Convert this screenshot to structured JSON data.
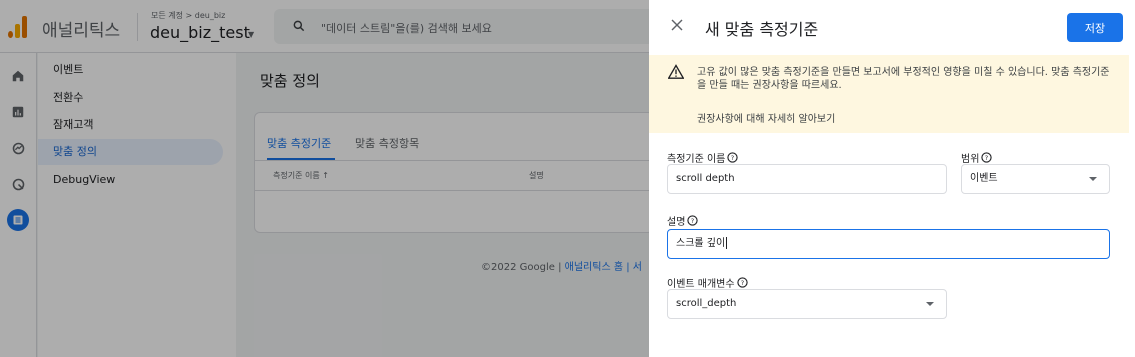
{
  "app": {
    "name": "애널리틱스",
    "account_path": "모든 계정 > deu_biz",
    "property": "deu_biz_test",
    "search_placeholder": "\"데이터 스트림\"을(를) 검색해 보세요"
  },
  "subnav": {
    "items": [
      {
        "label": "이벤트"
      },
      {
        "label": "전환수"
      },
      {
        "label": "잠재고객"
      },
      {
        "label": "맞춤 정의"
      },
      {
        "label": "DebugView"
      }
    ]
  },
  "main": {
    "title": "맞춤 정의",
    "tabs": [
      "맞춤 측정기준",
      "맞춤 측정항목"
    ],
    "columns": [
      "측정기준 이름 ↑",
      "설명"
    ],
    "footer_copyright": "©2022 Google |",
    "footer_link": "애널리틱스 홈 | 서"
  },
  "panel": {
    "title": "새 맞춤 측정기준",
    "save_label": "저장",
    "warning": "고유 값이 많은 맞춤 측정기준을 만들면 보고서에 부정적인 영향을 미칠 수 있습니다. 맞춤 측정기준을 만들 때는 권장사항을 따르세요.",
    "warning_link": "권장사항에 대해 자세히 알아보기",
    "dimension_name_label": "측정기준 이름",
    "dimension_name_value": "scroll depth",
    "scope_label": "범위",
    "scope_value": "이벤트",
    "description_label": "설명",
    "description_value": "스크롤 깊이",
    "event_param_label": "이벤트 매개변수",
    "event_param_value": "scroll_depth"
  },
  "colors": {
    "accent": "#1a73e8",
    "warning_bg": "#fef7e0",
    "brand_orange": "#e37400"
  }
}
